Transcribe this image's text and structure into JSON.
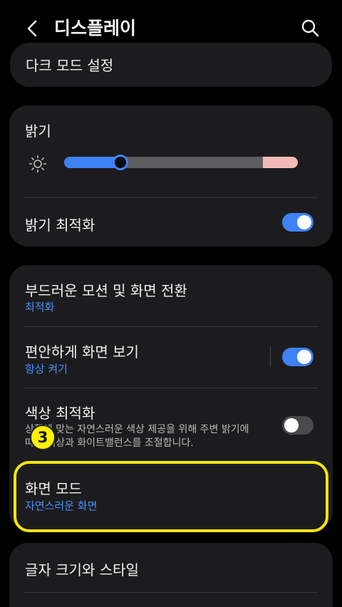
{
  "header": {
    "title": "디스플레이",
    "back_icon": "chevron-left-icon",
    "search_icon": "search-icon"
  },
  "dark_mode": {
    "label": "다크 모드 설정"
  },
  "brightness": {
    "label": "밝기",
    "level": 0.24,
    "extra_brightness_start": 0.85,
    "icon": "sun-icon",
    "adaptive_label": "밝기 최적화",
    "adaptive_on": true
  },
  "motion": {
    "label": "부드러운 모션 및 화면 전환",
    "value": "최적화"
  },
  "eye_comfort": {
    "label": "편안하게 화면 보기",
    "value": "항상 켜기",
    "on": true
  },
  "color_optimize": {
    "label": "색상 최적화",
    "desc_line1": "상황에 맞는 자연스러운 색상 제공을 위해 주변 밝기에",
    "desc_line2": "따라 색상과 화이트밸런스를 조절합니다.",
    "on": false
  },
  "screen_mode": {
    "label": "화면 모드",
    "value": "자연스러운 화면"
  },
  "font": {
    "label": "글자 크기와 스타일"
  },
  "step_badge": "3",
  "colors": {
    "accent": "#3e82f6",
    "link": "#4a8fff",
    "card": "#1c1c1e",
    "highlight": "#f5e50b",
    "badge": "#fff200",
    "over_brightness": "#f3bbb8"
  }
}
